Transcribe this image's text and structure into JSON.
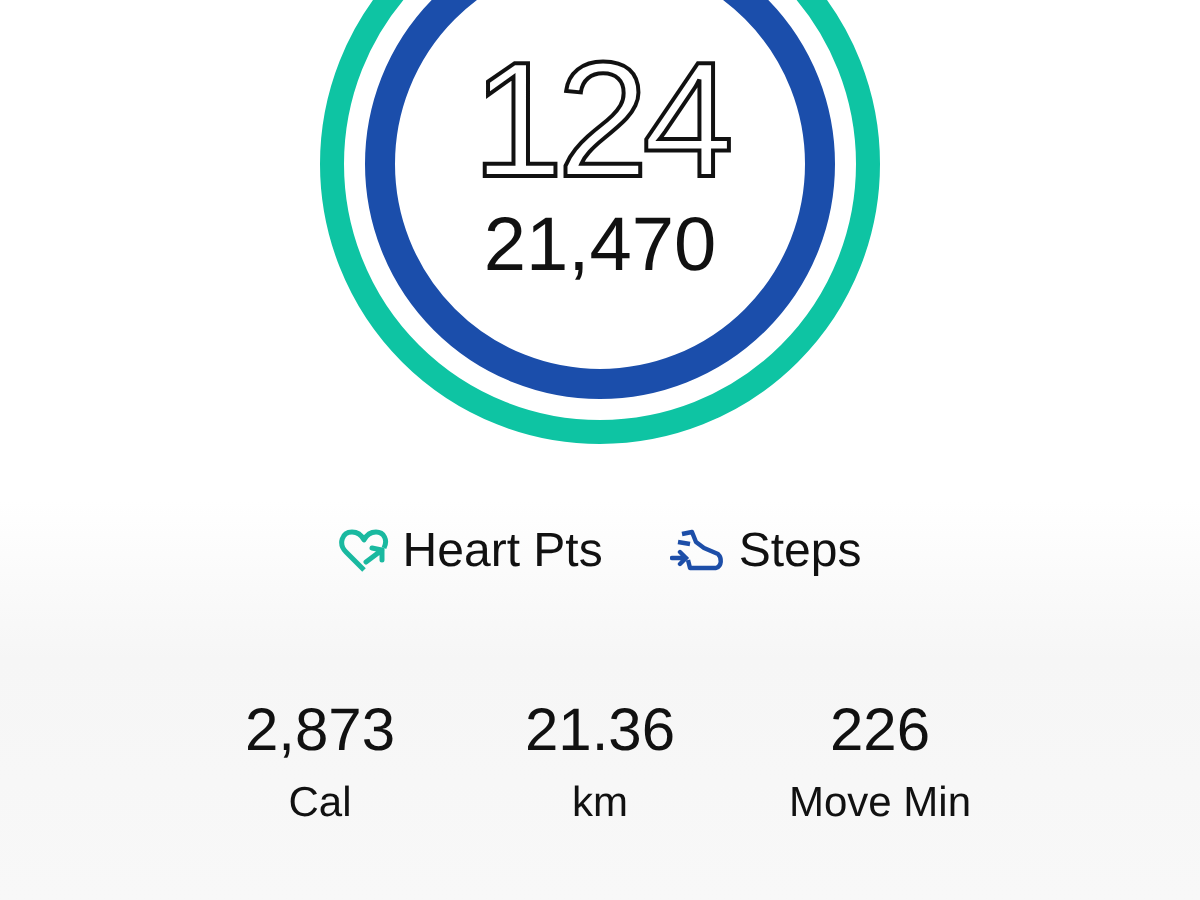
{
  "rings": {
    "heart_points": {
      "value": "124"
    },
    "steps": {
      "value": "21,470"
    }
  },
  "legend": [
    {
      "kind": "heart",
      "label": "Heart Pts"
    },
    {
      "kind": "steps",
      "label": "Steps"
    }
  ],
  "stats": [
    {
      "value": "2,873",
      "label": "Cal"
    },
    {
      "value": "21.36",
      "label": "km"
    },
    {
      "value": "226",
      "label": "Move Min"
    }
  ]
}
